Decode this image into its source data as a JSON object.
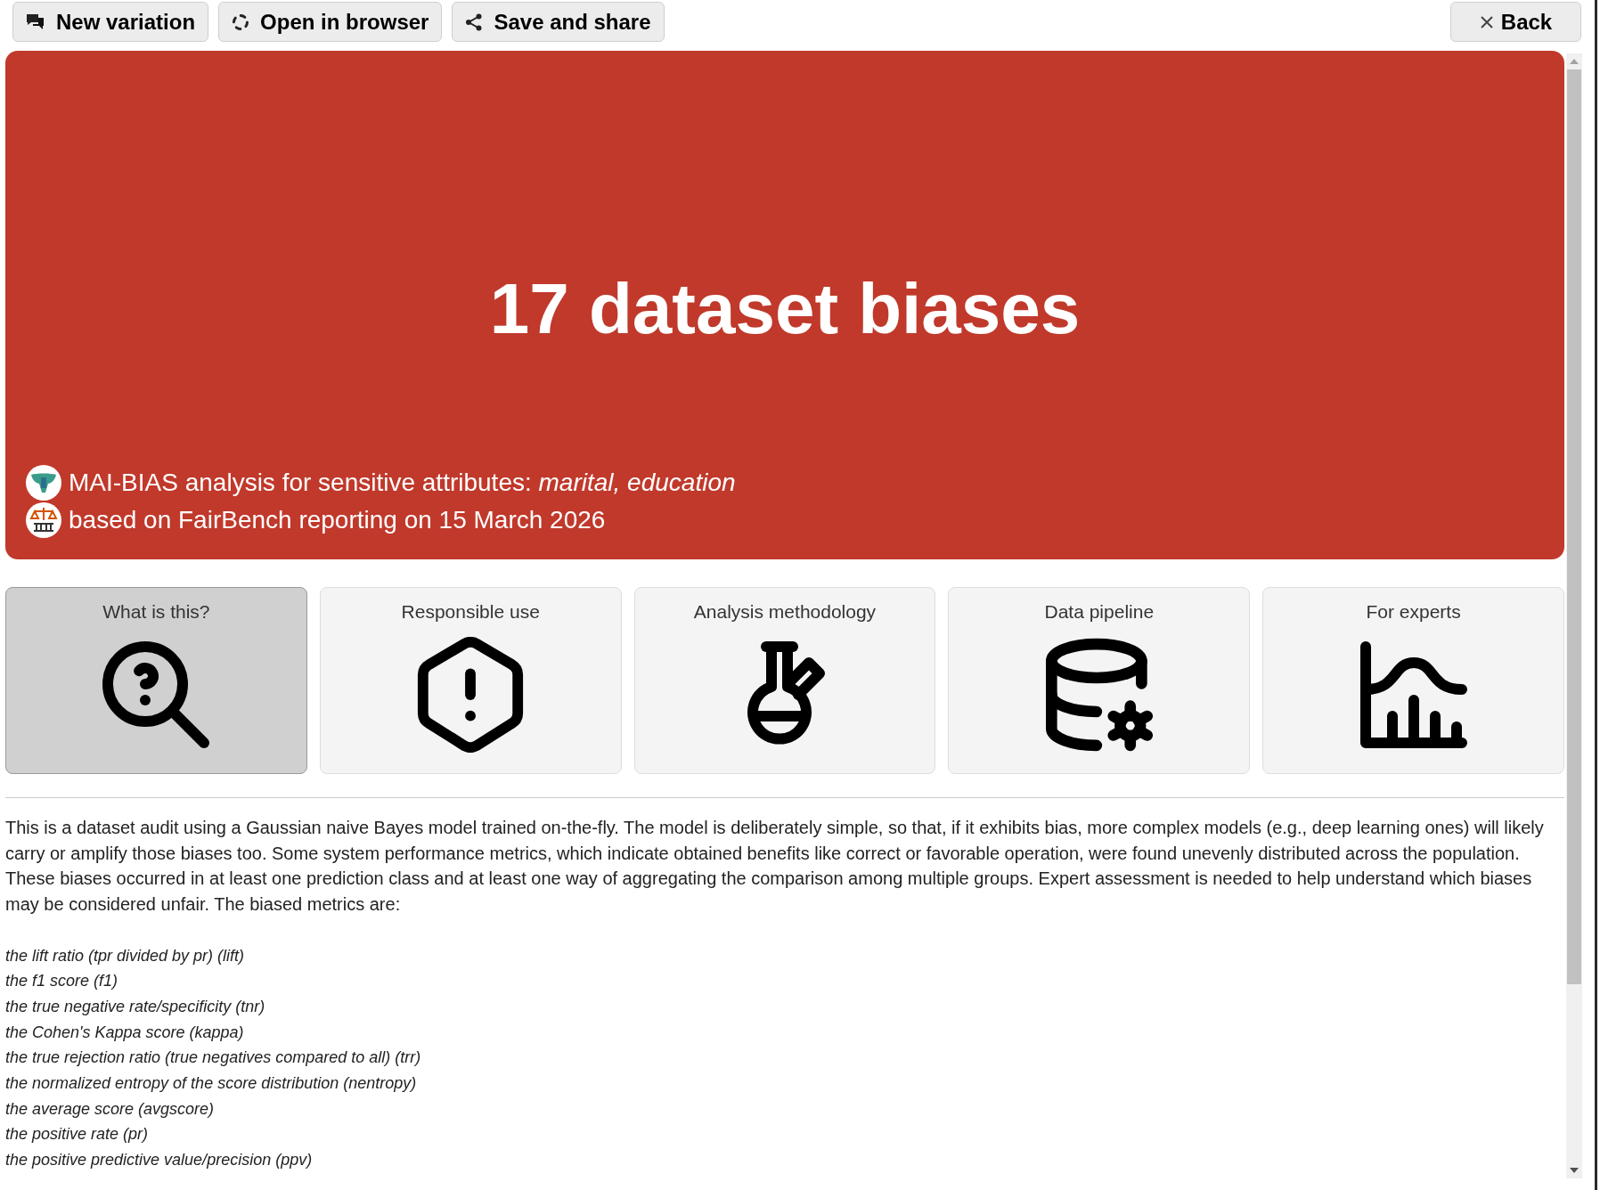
{
  "toolbar": {
    "buttons": [
      {
        "label": "New variation",
        "kind": "variation"
      },
      {
        "label": "Open in browser",
        "kind": "browser"
      },
      {
        "label": "Save and share",
        "kind": "share"
      }
    ],
    "back_button": {
      "label": "Back"
    }
  },
  "banner": {
    "title": "17 dataset biases",
    "lines": [
      {
        "kind": "analysis",
        "text": "MAI-BIAS analysis for sensitive attributes: *marital, education*"
      },
      {
        "kind": "report",
        "text": "based on FairBench reporting on 15 March 2026"
      }
    ]
  },
  "cards": [
    {
      "label": "What is this?",
      "kind": "help",
      "selected": true
    },
    {
      "label": "Responsible use",
      "kind": "responsible",
      "selected": false
    },
    {
      "label": "Analysis methodology",
      "kind": "methodology",
      "selected": false
    },
    {
      "label": "Data pipeline",
      "kind": "pipeline",
      "selected": false
    },
    {
      "label": "For experts",
      "kind": "experts",
      "selected": false
    }
  ],
  "description": {
    "paragraph": "This is a dataset audit using a Gaussian naive Bayes model trained on-the-fly. The model is deliberately simple, so that, if it exhibits bias, more complex models (e.g., deep learning ones) will likely carry or amplify those biases too. Some system performance metrics, which indicate obtained benefits like correct or favorable operation, were found unevenly distributed across the population. These biases occurred in at least one prediction class and at least one way of aggregating the comparison among multiple groups. Expert assessment is needed to help understand which biases may be considered unfair. The biased metrics are:",
    "metrics": [
      "the lift ratio (tpr divided by pr) (lift)",
      "the f1 score (f1)",
      "the true negative rate/specificity (tnr)",
      "the Cohen's Kappa score (kappa)",
      "the true rejection ratio (true negatives compared to all) (trr)",
      "the normalized entropy of the score distribution (nentropy)",
      "the average score (avgscore)",
      "the positive rate (pr)",
      "the positive predictive value/precision (ppv)"
    ]
  }
}
